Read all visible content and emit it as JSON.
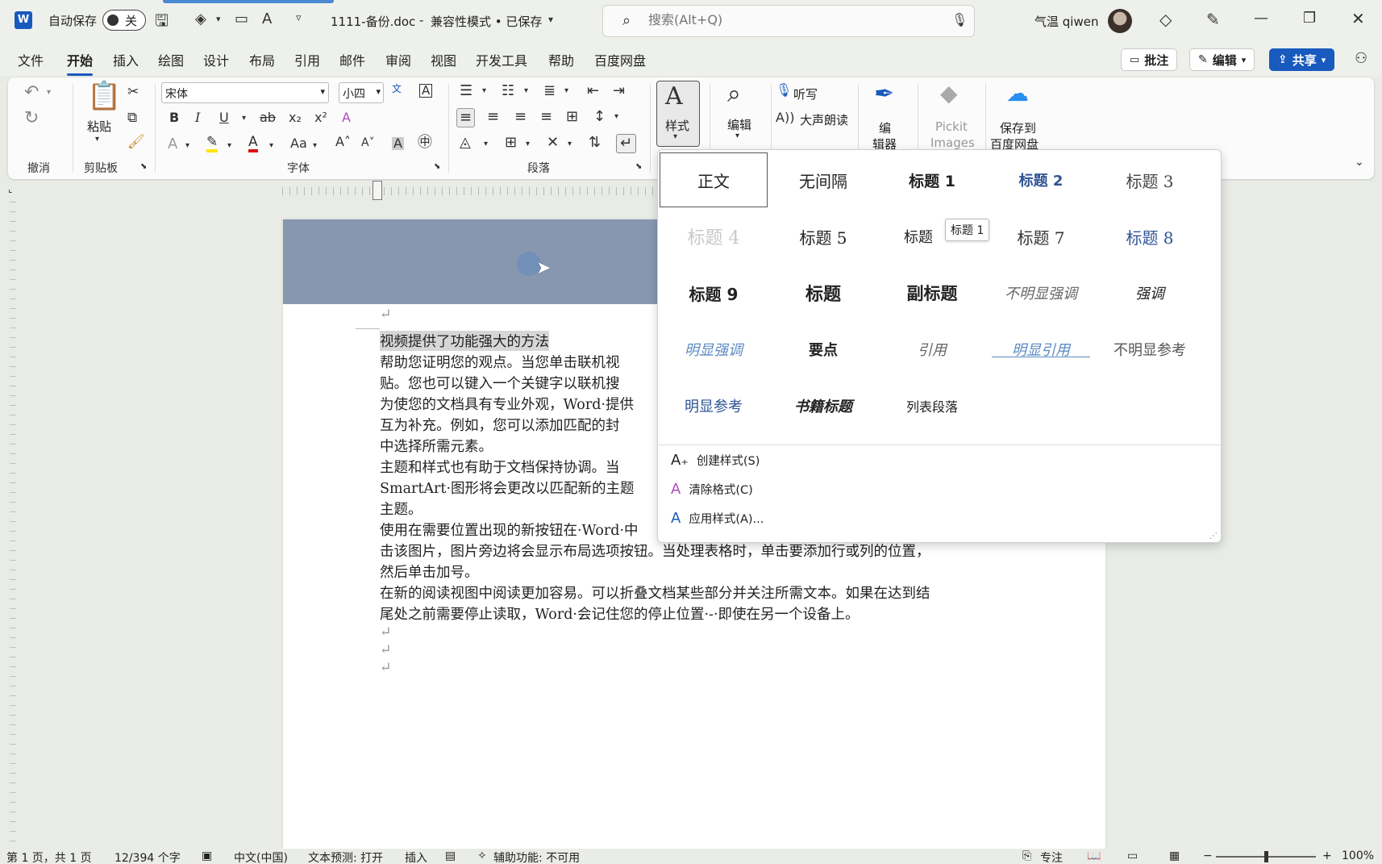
{
  "titlebar": {
    "autosave_label": "自动保存",
    "autosave_state": "关",
    "filename": "1111-备份.doc",
    "mode": "兼容性模式 • 已保存",
    "separator": "-",
    "search_placeholder": "搜索(Alt+Q)",
    "user": "气温 qiwen"
  },
  "menu": {
    "tabs": [
      "文件",
      "开始",
      "插入",
      "绘图",
      "设计",
      "布局",
      "引用",
      "邮件",
      "审阅",
      "视图",
      "开发工具",
      "帮助",
      "百度网盘"
    ],
    "active": "开始",
    "comments_btn": "批注",
    "edit_btn": "编辑",
    "share_btn": "共享"
  },
  "ribbon": {
    "groups": {
      "undo": "撤消",
      "clipboard": "剪贴板",
      "font": "字体",
      "paragraph": "段落"
    },
    "paste": "粘贴",
    "font_name": "宋体",
    "font_size": "小四",
    "styles": "样式",
    "editing": "编辑",
    "dictate": "听写",
    "read_aloud": "大声朗读",
    "editor_line1": "编",
    "editor_line2": "辑器",
    "pickit_line1": "Pickit",
    "pickit_line2": "Images",
    "baidu_line1": "保存到",
    "baidu_line2": "百度网盘"
  },
  "styles_panel": {
    "rows": [
      [
        "正文",
        "无间隔",
        "标题 1",
        "标题 2",
        "标题 3"
      ],
      [
        "标题 4",
        "标题 5",
        "标题",
        "标题 7",
        "标题 8"
      ],
      [
        "标题 9",
        "标题",
        "副标题",
        "不明显强调",
        "强调"
      ],
      [
        "明显强调",
        "要点",
        "引用",
        "明显引用",
        "不明显参考"
      ],
      [
        "明显参考",
        "书籍标题",
        "列表段落"
      ]
    ],
    "tooltip": "标题 1",
    "actions": [
      "创建样式(S)",
      "清除格式(C)",
      "应用样式(A)..."
    ]
  },
  "document": {
    "lines": [
      "视频提供了功能强大的方法",
      "帮助您证明您的观点。当您单击联机视",
      "贴。您也可以键入一个关键字以联机搜",
      "为使您的文档具有专业外观，Word·提供",
      "互为补充。例如，您可以添加匹配的封",
      "中选择所需元素。",
      "主题和样式也有助于文档保持协调。当",
      "SmartArt·图形将会更改以匹配新的主题",
      "主题。",
      "使用在需要位置出现的新按钮在·Word·中",
      "击该图片，图片旁边将会显示布局选项按钮。当处理表格时，单击要添加行或列的位置，",
      "然后单击加号。",
      "在新的阅读视图中阅读更加容易。可以折叠文档某些部分并关注所需文本。如果在达到结",
      "尾处之前需要停止读取，Word·会记住您的停止位置·-·即使在另一个设备上。"
    ]
  },
  "statusbar": {
    "page": "第 1 页，共 1 页",
    "words": "12/394 个字",
    "language": "中文(中国)",
    "prediction": "文本预测: 打开",
    "insert": "插入",
    "accessibility": "辅助功能: 不可用",
    "focus": "专注",
    "zoom_level": "100%"
  },
  "colors": {
    "accent": "#185abd",
    "header_band": "#8897b0",
    "heading_blue": "#2f5496"
  }
}
